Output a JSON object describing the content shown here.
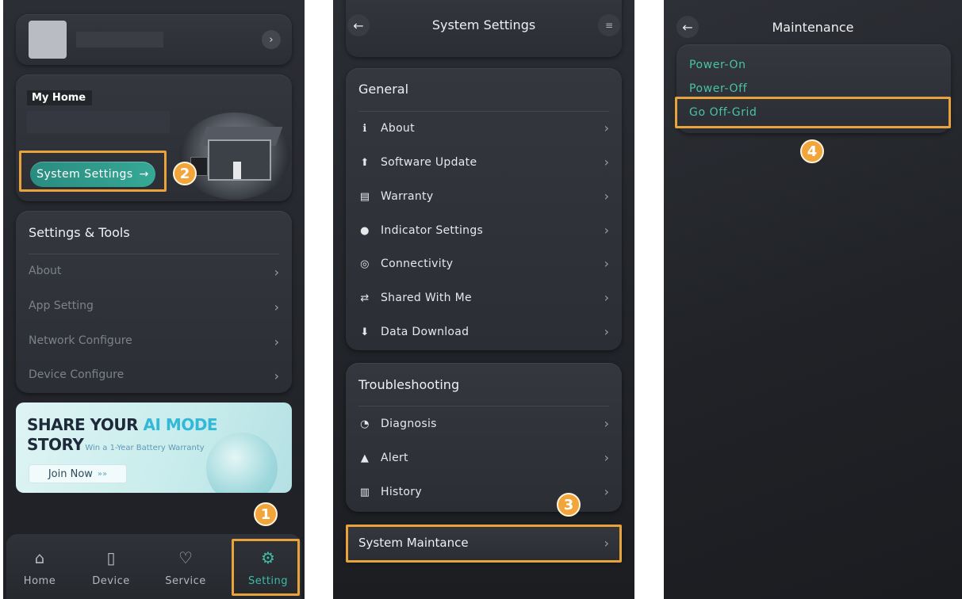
{
  "colors": {
    "accent": "#3dbca6",
    "highlight": "#e8a33c",
    "badge": "#f2a53a",
    "maintenance_text": "#49c2a8"
  },
  "screen1": {
    "profile": {
      "chevron": "›"
    },
    "home": {
      "title": "My Home",
      "system_settings_button": "System Settings",
      "button_arrow": "→"
    },
    "settings_tools": {
      "title": "Settings & Tools",
      "items": [
        {
          "label": "About",
          "chevron": "›"
        },
        {
          "label": "App Setting",
          "chevron": "›"
        },
        {
          "label": "Network Configure",
          "chevron": "›"
        },
        {
          "label": "Device Configure",
          "chevron": "›"
        }
      ]
    },
    "promo": {
      "line1": "SHARE YOUR ",
      "line1_highlight": "AI MODE",
      "line2": "STORY",
      "subtitle": "Win a 1-Year Battery Warranty",
      "join_button": "Join Now",
      "join_arrows": "»»"
    },
    "tabs": [
      {
        "label": "Home",
        "icon": "home-icon",
        "glyph": "⌂"
      },
      {
        "label": "Device",
        "icon": "device-icon",
        "glyph": "▯"
      },
      {
        "label": "Service",
        "icon": "service-icon",
        "glyph": "♡"
      },
      {
        "label": "Setting",
        "icon": "gear-icon",
        "glyph": "⚙"
      }
    ],
    "badges": {
      "step1": "1",
      "step2": "2"
    }
  },
  "screen2": {
    "header": {
      "back": "←",
      "title": "System Settings",
      "menu": "≡"
    },
    "general": {
      "title": "General",
      "items": [
        {
          "label": "About",
          "icon": "info-icon",
          "glyph": "ℹ",
          "chevron": "›"
        },
        {
          "label": "Software Update",
          "icon": "update-icon",
          "glyph": "⬆",
          "chevron": "›"
        },
        {
          "label": "Warranty",
          "icon": "warranty-icon",
          "glyph": "▤",
          "chevron": "›"
        },
        {
          "label": "Indicator Settings",
          "icon": "indicator-icon",
          "glyph": "●",
          "chevron": "›"
        },
        {
          "label": "Connectivity",
          "icon": "connectivity-icon",
          "glyph": "◎",
          "chevron": "›"
        },
        {
          "label": "Shared With Me",
          "icon": "share-icon",
          "glyph": "⇄",
          "chevron": "›"
        },
        {
          "label": "Data Download",
          "icon": "download-icon",
          "glyph": "⬇",
          "chevron": "›"
        }
      ]
    },
    "troubleshooting": {
      "title": "Troubleshooting",
      "items": [
        {
          "label": "Diagnosis",
          "icon": "diagnosis-icon",
          "glyph": "◔",
          "chevron": "›"
        },
        {
          "label": "Alert",
          "icon": "alert-icon",
          "glyph": "▲",
          "chevron": "›"
        },
        {
          "label": "History",
          "icon": "history-icon",
          "glyph": "▥",
          "chevron": "›"
        }
      ]
    },
    "maintenance_row": {
      "label": "System Maintance",
      "chevron": "›"
    },
    "badges": {
      "step3": "3"
    }
  },
  "screen3": {
    "header": {
      "back": "←",
      "title": "Maintenance"
    },
    "items": [
      {
        "label": "Power-On"
      },
      {
        "label": "Power-Off"
      },
      {
        "label": "Go Off-Grid"
      }
    ],
    "badges": {
      "step4": "4"
    }
  }
}
